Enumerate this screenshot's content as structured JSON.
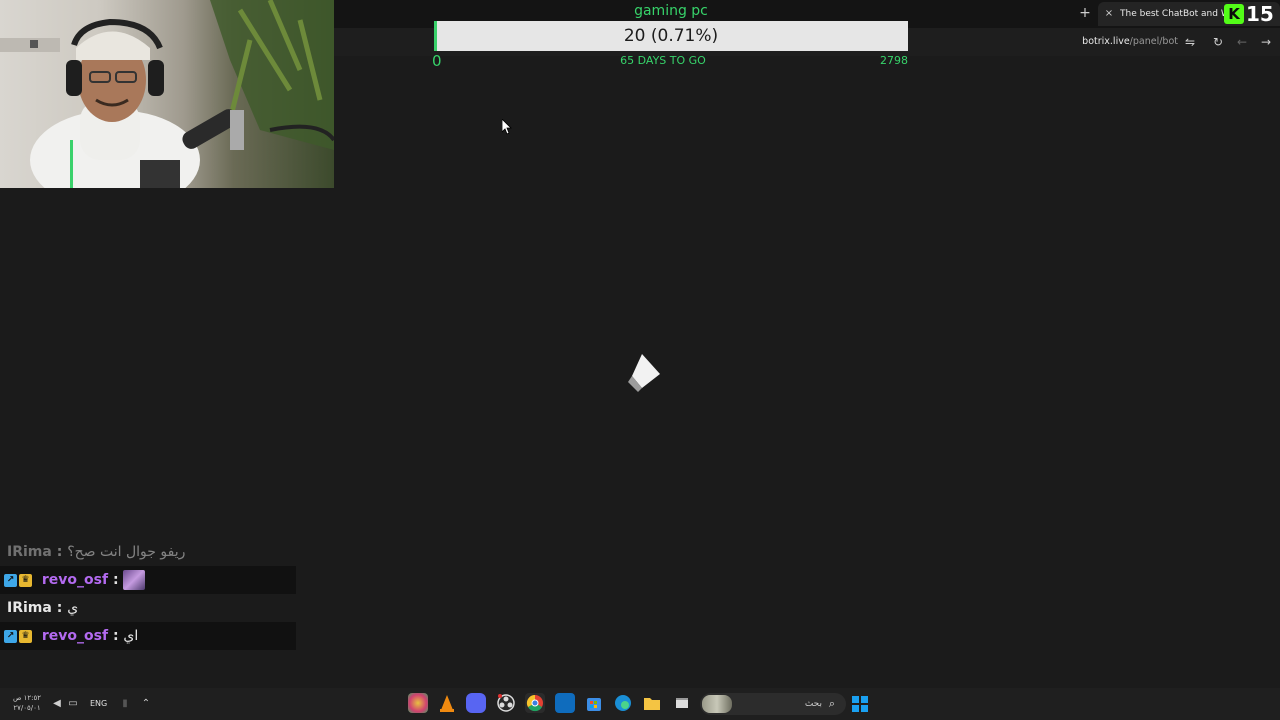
{
  "browser": {
    "tab_title": "The best ChatBot and Widgets",
    "tab_close": "×",
    "new_tab": "+",
    "url_host": "botrix.live",
    "url_path": "/panel/bot",
    "kick_logo_letter": "K",
    "kick_count": "15"
  },
  "goal": {
    "title": "gaming pc",
    "progress_text": "20 (0.71%)",
    "progress_fraction": 0.0071,
    "start_value": "0",
    "days_left": "65 DAYS TO GO",
    "target_value": "2798",
    "accent_color": "#37d36a"
  },
  "chat": {
    "messages": [
      {
        "user": "IRima",
        "text": "ريفو جوال انت صح؟",
        "badges": [],
        "emote": false
      },
      {
        "user": "revo_osf",
        "text": "",
        "badges": [
          "moderator-icon",
          "vip-crown-icon"
        ],
        "emote": true
      },
      {
        "user": "IRima",
        "text": "ي",
        "badges": [],
        "emote": false
      },
      {
        "user": "revo_osf",
        "text": "اي",
        "badges": [
          "moderator-icon",
          "vip-crown-icon"
        ],
        "emote": false
      }
    ],
    "separator": ":"
  },
  "taskbar": {
    "time": "١٢:٥٢ ص",
    "date": "٢٧/٠٥/٠١",
    "language": "ENG",
    "search_placeholder": "بحث",
    "apps": [
      "photo-app-icon",
      "vlc-icon",
      "discord-icon",
      "obs-icon",
      "chrome-icon",
      "outlook-icon",
      "store-icon",
      "edge-icon",
      "file-explorer-icon",
      "app-window-icon"
    ]
  }
}
